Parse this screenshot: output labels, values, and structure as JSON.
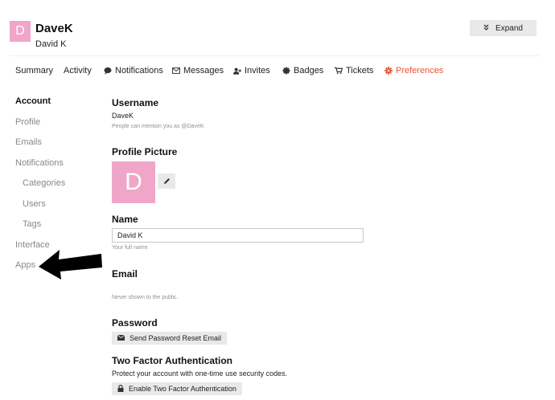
{
  "header": {
    "avatar_letter": "D",
    "username": "DaveK",
    "full_name": "David K",
    "expand_label": "Expand"
  },
  "nav": {
    "items": [
      {
        "label": "Summary",
        "icon": null
      },
      {
        "label": "Activity",
        "icon": null
      },
      {
        "label": "Notifications",
        "icon": "comment-icon"
      },
      {
        "label": "Messages",
        "icon": "envelope-icon"
      },
      {
        "label": "Invites",
        "icon": "user-plus-icon"
      },
      {
        "label": "Badges",
        "icon": "certificate-icon"
      },
      {
        "label": "Tickets",
        "icon": "cart-icon"
      },
      {
        "label": "Preferences",
        "icon": "gear-icon",
        "active": true
      }
    ]
  },
  "sidebar": {
    "items": [
      {
        "label": "Account",
        "active": true
      },
      {
        "label": "Profile"
      },
      {
        "label": "Emails"
      },
      {
        "label": "Notifications"
      },
      {
        "label": "Categories"
      },
      {
        "label": "Users"
      },
      {
        "label": "Tags"
      },
      {
        "label": "Interface"
      },
      {
        "label": "Apps"
      }
    ]
  },
  "account": {
    "username_heading": "Username",
    "username_value": "DaveK",
    "username_hint": "People can mention you as @DaveK",
    "profile_picture_heading": "Profile Picture",
    "avatar_letter": "D",
    "name_heading": "Name",
    "name_value": "David K",
    "name_hint": "Your full name",
    "email_heading": "Email",
    "email_hint": "Never shown to the public.",
    "password_heading": "Password",
    "password_button": "Send Password Reset Email",
    "tfa_heading": "Two Factor Authentication",
    "tfa_description": "Protect your account with one-time use security codes.",
    "tfa_button": "Enable Two Factor Authentication"
  },
  "colors": {
    "accent": "#e45735",
    "avatar": "#f0a6c8",
    "button_bg": "#e9e9e9",
    "muted_text": "#888888"
  }
}
